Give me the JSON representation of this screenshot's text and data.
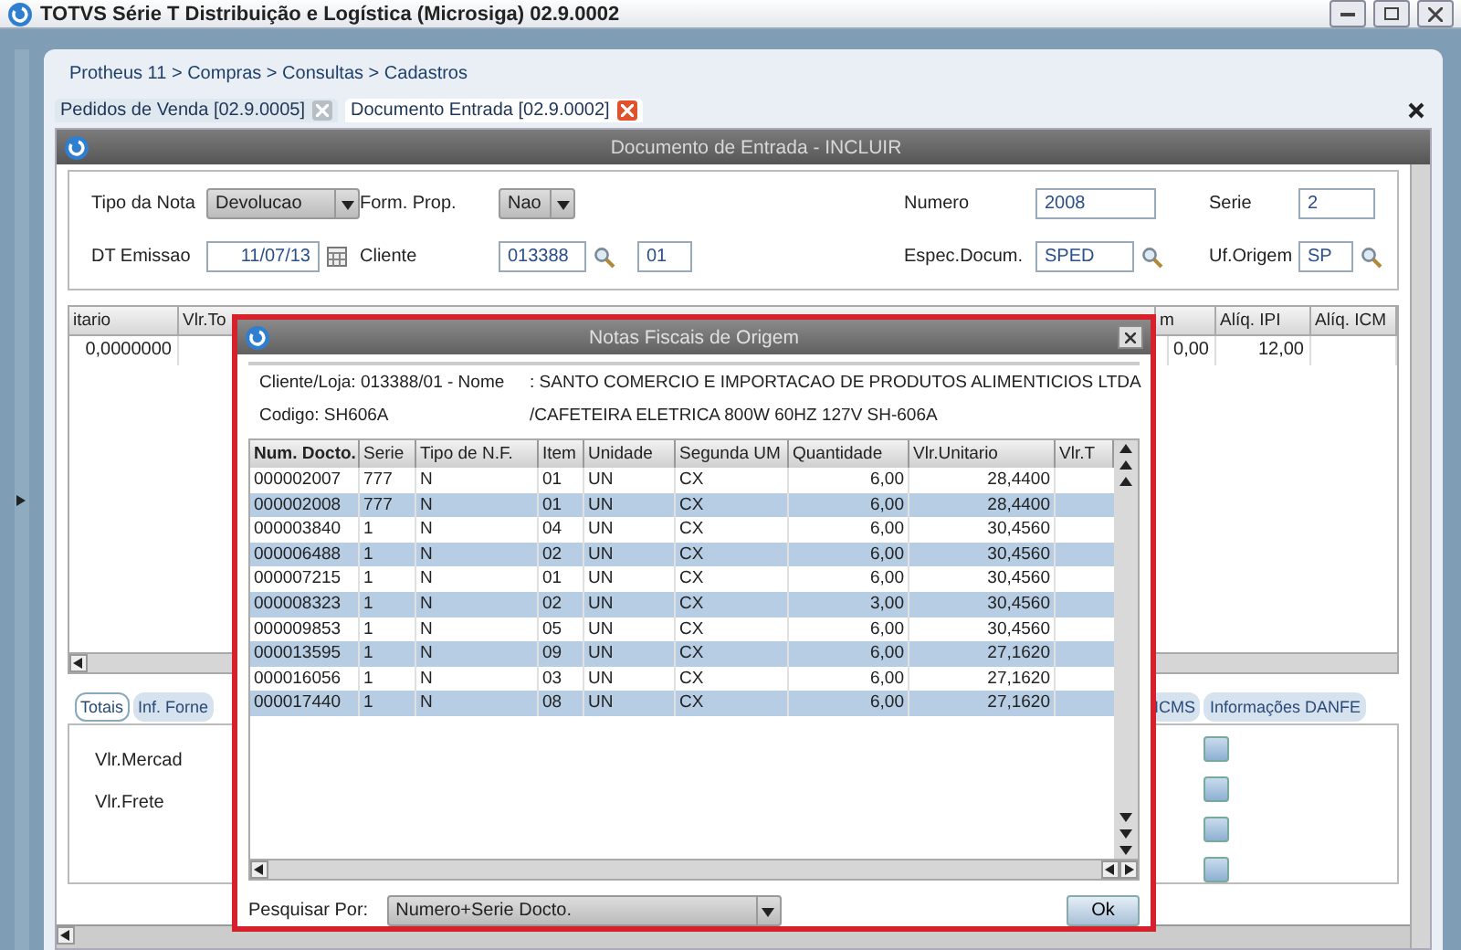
{
  "window": {
    "title": "TOTVS Série T Distribuição e Logística (Microsiga) 02.9.0002"
  },
  "breadcrumb": "Protheus 11 > Compras  > Consultas > Cadastros",
  "tabs": [
    {
      "label": "Pedidos de Venda [02.9.0005]",
      "selected": false
    },
    {
      "label": "Documento Entrada [02.9.0002]",
      "selected": true
    }
  ],
  "document": {
    "title": "Documento de Entrada - INCLUIR",
    "row_1": [
      {
        "label": "Tipo da Nota",
        "kind": "select",
        "value": "Devolucao"
      },
      {
        "label": "Form. Prop.",
        "kind": "select",
        "value": "Nao"
      },
      {
        "label": "Numero",
        "kind": "input",
        "value": "2008"
      },
      {
        "label": "Serie",
        "kind": "input",
        "value": "2"
      }
    ],
    "row_2": [
      {
        "label": "DT Emissao",
        "kind": "date",
        "value": "11/07/13"
      },
      {
        "label": "Cliente",
        "kind": "lookup",
        "value": "013388",
        "extra": "01"
      },
      {
        "label": "Espec.Docum.",
        "kind": "lookup",
        "value": "SPED"
      },
      {
        "label": "Uf.Origem",
        "kind": "lookup",
        "value": "SP"
      }
    ],
    "items_table": {
      "columns": [
        "itario",
        "Vlr.To",
        "",
        "m",
        "Alíq. IPI",
        "Alíq. ICM"
      ],
      "rows": [
        [
          "0,0000000",
          "",
          "",
          "0,00",
          "12,00",
          ""
        ]
      ]
    },
    "bottom_tabs": [
      {
        "label": "Totais",
        "selected": true
      },
      {
        "label": "Inf. Forne",
        "selected": false
      },
      {
        "label": "ICMS",
        "selected": false
      },
      {
        "label": "Informações DANFE",
        "selected": false
      }
    ],
    "totals": [
      "Vlr.Mercad",
      "Vlr.Frete"
    ]
  },
  "dialog": {
    "title": "Notas Fiscais de Origem",
    "client": "Cliente/Loja: 013388/01  -  Nome",
    "client_name": ": SANTO COMERCIO E IMPORTACAO DE PRODUTOS ALIMENTICIOS LTDA",
    "product": "Codigo: SH606A",
    "product_name": "/CAFETEIRA ELETRICA 800W 60HZ 127V SH-606A",
    "columns": [
      "Num. Docto.",
      "Serie",
      "Tipo de N.F.",
      "Item",
      "Unidade",
      "Segunda UM",
      "Quantidade",
      "Vlr.Unitario",
      "Vlr.T"
    ],
    "rows": [
      [
        "000002007",
        "777",
        "N",
        "01",
        "UN",
        "CX",
        "6,00",
        "28,4400"
      ],
      [
        "000002008",
        "777",
        "N",
        "01",
        "UN",
        "CX",
        "6,00",
        "28,4400"
      ],
      [
        "000003840",
        "1",
        "N",
        "04",
        "UN",
        "CX",
        "6,00",
        "30,4560"
      ],
      [
        "000006488",
        "1",
        "N",
        "02",
        "UN",
        "CX",
        "6,00",
        "30,4560"
      ],
      [
        "000007215",
        "1",
        "N",
        "01",
        "UN",
        "CX",
        "6,00",
        "30,4560"
      ],
      [
        "000008323",
        "1",
        "N",
        "02",
        "UN",
        "CX",
        "3,00",
        "30,4560"
      ],
      [
        "000009853",
        "1",
        "N",
        "05",
        "UN",
        "CX",
        "6,00",
        "30,4560"
      ],
      [
        "000013595",
        "1",
        "N",
        "09",
        "UN",
        "CX",
        "6,00",
        "27,1620"
      ],
      [
        "000016056",
        "1",
        "N",
        "03",
        "UN",
        "CX",
        "6,00",
        "27,1620"
      ],
      [
        "000017440",
        "1",
        "N",
        "08",
        "UN",
        "CX",
        "6,00",
        "27,1620"
      ]
    ],
    "search_label": "Pesquisar Por:",
    "search_by": "Numero+Serie Docto.",
    "ok": "Ok"
  }
}
